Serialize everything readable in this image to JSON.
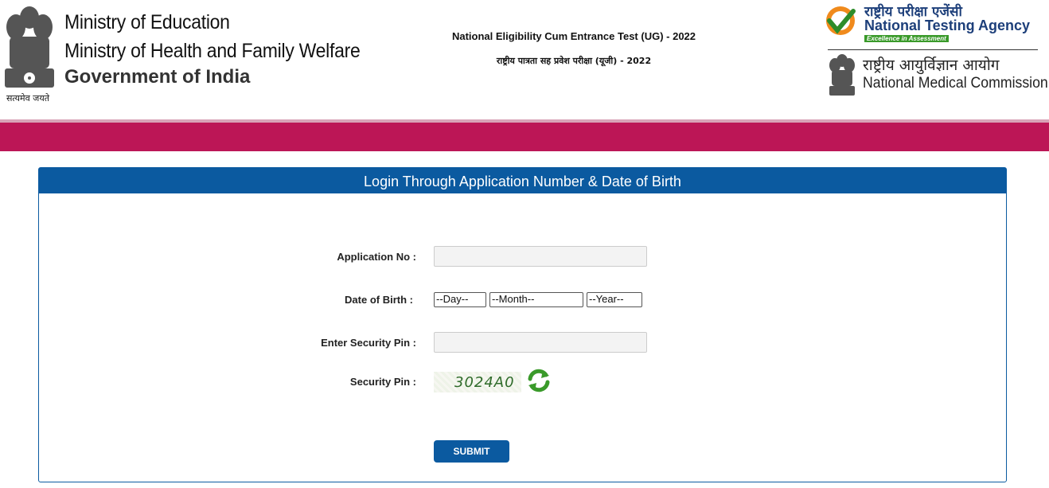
{
  "header": {
    "emblem_caption": "सत्यमेव जयते",
    "ministry_line1": "Ministry of Education",
    "ministry_line2": "Ministry of Health and Family Welfare",
    "ministry_line3": "Government of India",
    "exam_title": "National Eligibility Cum Entrance Test (UG) - 2022",
    "exam_title_hindi": "राष्ट्रीय पात्रता सह प्रवेश परीक्षा (यूजी) - 2022",
    "nta_hindi": "राष्ट्रीय परीक्षा एजेंसी",
    "nta_name": "National Testing Agency",
    "nta_tagline": "Excellence in Assessment",
    "nmc_hindi": "राष्ट्रीय आयुर्विज्ञान आयोग",
    "nmc_name": "National Medical Commission"
  },
  "colors": {
    "band": "#bc1656",
    "primary": "#0b5aa0"
  },
  "form": {
    "title": "Login Through Application Number & Date of Birth",
    "application_no_label": "Application No :",
    "application_no_value": "",
    "dob_label": "Date of Birth :",
    "day_selected": "--Day--",
    "month_selected": "--Month--",
    "year_selected": "--Year--",
    "security_pin_input_label": "Enter Security Pin :",
    "security_pin_input_value": "",
    "security_pin_label": "Security Pin :",
    "captcha_text": "3024A0",
    "refresh_icon": "refresh-icon",
    "submit_label": "SUBMIT"
  }
}
